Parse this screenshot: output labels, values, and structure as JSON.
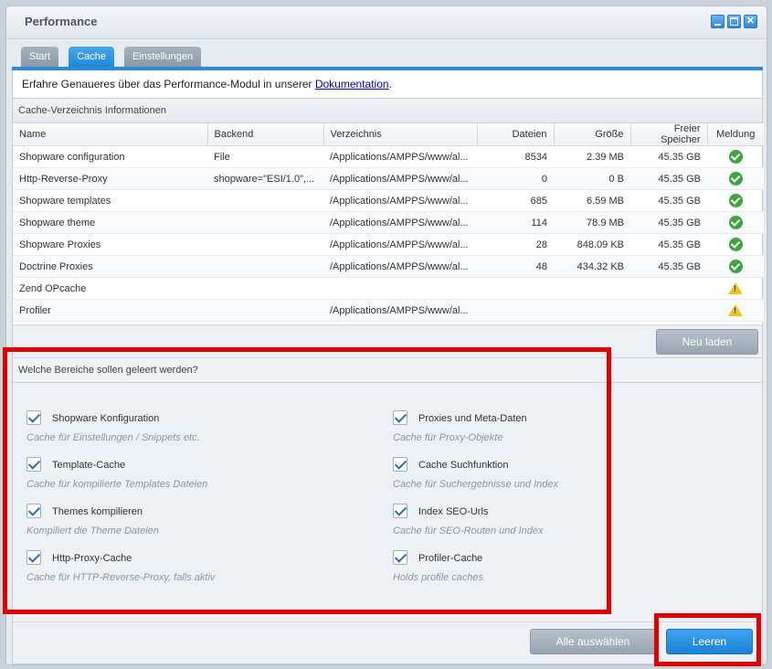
{
  "window": {
    "title": "Performance"
  },
  "tabs": [
    {
      "label": "Start"
    },
    {
      "label": "Cache"
    },
    {
      "label": "Einstellungen"
    }
  ],
  "info": {
    "text": "Erfahre Genaueres über das Performance-Modul in unserer ",
    "link": "Dokumentation",
    "suffix": "."
  },
  "cache_panel": {
    "title": "Cache-Verzeichnis Informationen",
    "columns": [
      "Name",
      "Backend",
      "Verzeichnis",
      "Dateien",
      "Größe",
      "Freier Speicher",
      "Meldung"
    ],
    "rows": [
      {
        "name": "Shopware configuration",
        "backend": "File",
        "dir": "/Applications/AMPPS/www/al...",
        "files": "8534",
        "size": "2.39 MB",
        "free": "45.35 GB",
        "status": "ok-icon"
      },
      {
        "name": "Http-Reverse-Proxy",
        "backend": "shopware=\"ESI/1.0\",...",
        "dir": "/Applications/AMPPS/www/al...",
        "files": "0",
        "size": "0 B",
        "free": "45.35 GB",
        "status": "ok-icon"
      },
      {
        "name": "Shopware templates",
        "backend": "",
        "dir": "/Applications/AMPPS/www/al...",
        "files": "685",
        "size": "6.59 MB",
        "free": "45.35 GB",
        "status": "ok-icon"
      },
      {
        "name": "Shopware theme",
        "backend": "",
        "dir": "/Applications/AMPPS/www/al...",
        "files": "114",
        "size": "78.9 MB",
        "free": "45.35 GB",
        "status": "ok-icon"
      },
      {
        "name": "Shopware Proxies",
        "backend": "",
        "dir": "/Applications/AMPPS/www/al...",
        "files": "28",
        "size": "848.09 KB",
        "free": "45.35 GB",
        "status": "ok-icon"
      },
      {
        "name": "Doctrine Proxies",
        "backend": "",
        "dir": "/Applications/AMPPS/www/al...",
        "files": "48",
        "size": "434.32 KB",
        "free": "45.35 GB",
        "status": "ok-icon"
      },
      {
        "name": "Zend OPcache",
        "backend": "",
        "dir": "",
        "files": "",
        "size": "",
        "free": "",
        "status": "warning-icon"
      },
      {
        "name": "Profiler",
        "backend": "",
        "dir": "/Applications/AMPPS/www/al...",
        "files": "",
        "size": "",
        "free": "",
        "status": "warning-icon"
      }
    ],
    "reload_label": "Neu laden"
  },
  "clear_panel": {
    "title": "Welche Bereiche sollen geleert werden?",
    "items": [
      {
        "label": "Shopware Konfiguration",
        "desc": "Cache für Einstellungen / Snippets etc.",
        "checked": true
      },
      {
        "label": "Template-Cache",
        "desc": "Cache für kompilierte Templates Dateien",
        "checked": true
      },
      {
        "label": "Themes kompilieren",
        "desc": "Kompiliert die Theme Dateien",
        "checked": true
      },
      {
        "label": "Http-Proxy-Cache",
        "desc": "Cache für HTTP-Reverse-Proxy, falls aktiv",
        "checked": true
      },
      {
        "label": "Proxies und Meta-Daten",
        "desc": "Cache für Proxy-Objekte",
        "checked": true
      },
      {
        "label": "Cache Suchfunktion",
        "desc": "Cache für Suchergebnisse und Index",
        "checked": true
      },
      {
        "label": "Index SEO-Urls",
        "desc": "Cache für SEO-Routen und Index",
        "checked": true
      },
      {
        "label": "Profiler-Cache",
        "desc": "Holds profile caches",
        "checked": true
      }
    ]
  },
  "footer": {
    "select_all_label": "Alle auswählen",
    "clear_label": "Leeren"
  },
  "colors": {
    "accent": "#1f87d9",
    "highlight": "#e30000",
    "ok": "#3fa43b",
    "warning": "#f0c419"
  }
}
